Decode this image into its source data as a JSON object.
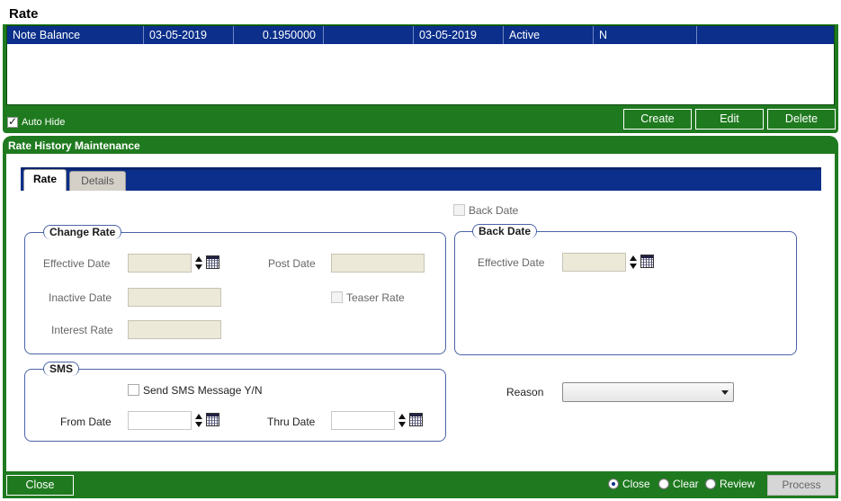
{
  "page": {
    "title": "Rate"
  },
  "grid": {
    "row": [
      "Note Balance",
      "03-05-2019",
      "0.1950000",
      "",
      "03-05-2019",
      "Active",
      "N",
      ""
    ],
    "auto_hide_label": "Auto Hide",
    "auto_hide_checked": true,
    "buttons": {
      "create": "Create",
      "edit": "Edit",
      "delete": "Delete"
    }
  },
  "maintenance": {
    "title": "Rate History Maintenance",
    "tabs": [
      "Rate",
      "Details"
    ],
    "back_date_checkbox": "Back Date",
    "change_rate": {
      "legend": "Change Rate",
      "effective_date": "Effective Date",
      "post_date": "Post Date",
      "inactive_date": "Inactive Date",
      "teaser_rate": "Teaser Rate",
      "interest_rate": "Interest Rate"
    },
    "back_date": {
      "legend": "Back Date",
      "effective_date": "Effective Date"
    },
    "sms": {
      "legend": "SMS",
      "send_sms": "Send SMS Message Y/N",
      "from_date": "From Date",
      "thru_date": "Thru Date"
    },
    "reason": {
      "label": "Reason",
      "value": ""
    }
  },
  "footer": {
    "close_button": "Close",
    "radios": [
      "Close",
      "Clear",
      "Review"
    ],
    "selected_radio": "Close",
    "process_button": "Process"
  },
  "colors": {
    "panel_green": "#1f7a1f",
    "header_blue": "#0b2f8a"
  }
}
